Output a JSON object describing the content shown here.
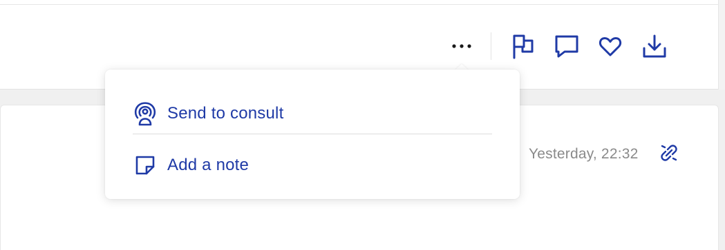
{
  "colors": {
    "accent": "#1f3aa6",
    "muted_text": "#8a8a8a",
    "background": "#f0f0f0",
    "card": "#ffffff"
  },
  "toolbar": {
    "more_icon": "ellipsis-icon",
    "buttons": [
      {
        "name": "flag-button",
        "icon": "flag-icon"
      },
      {
        "name": "comment-button",
        "icon": "comment-icon"
      },
      {
        "name": "favorite-button",
        "icon": "heart-icon"
      },
      {
        "name": "download-button",
        "icon": "download-icon"
      }
    ]
  },
  "dropdown": {
    "items": [
      {
        "label": "Send to consult",
        "icon": "broadcast-icon"
      },
      {
        "label": "Add a note",
        "icon": "note-icon"
      }
    ]
  },
  "message": {
    "timestamp": "Yesterday, 22:32",
    "link_icon": "unlink-icon"
  }
}
